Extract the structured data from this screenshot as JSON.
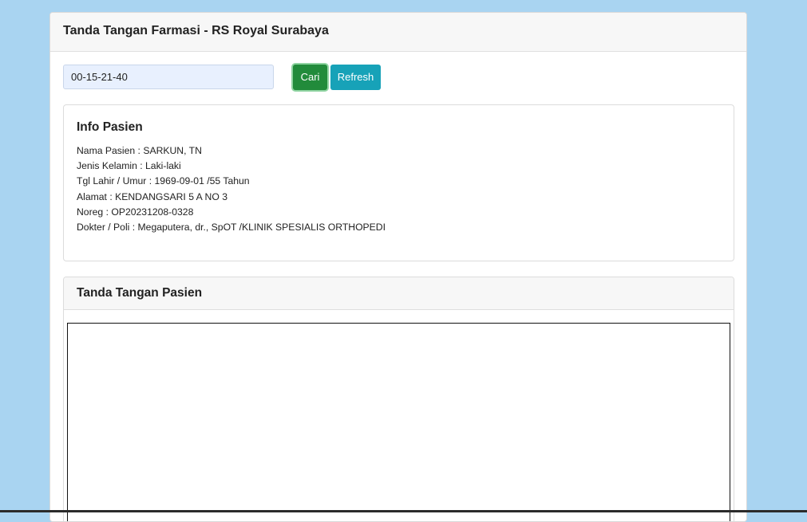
{
  "card": {
    "title": "Tanda Tangan Farmasi - RS Royal Surabaya"
  },
  "search": {
    "value": "00-15-21-40",
    "search_label": "Cari",
    "refresh_label": "Refresh"
  },
  "patient_info": {
    "title": "Info Pasien",
    "lines": [
      "Nama Pasien : SARKUN, TN",
      "Jenis Kelamin : Laki-laki",
      "Tgl Lahir / Umur : 1969-09-01 /55 Tahun",
      "Alamat : KENDANGSARI 5 A NO 3",
      "Noreg : OP20231208-0328",
      "Dokter / Poli : Megaputera, dr., SpOT /KLINIK SPESIALIS ORTHOPEDI"
    ]
  },
  "signature": {
    "title": "Tanda Tangan Pasien"
  },
  "colors": {
    "page_background": "#a9d4f1",
    "search_button": "#228b3b",
    "refresh_button": "#17a2b8",
    "input_background": "#e8f0fe"
  }
}
